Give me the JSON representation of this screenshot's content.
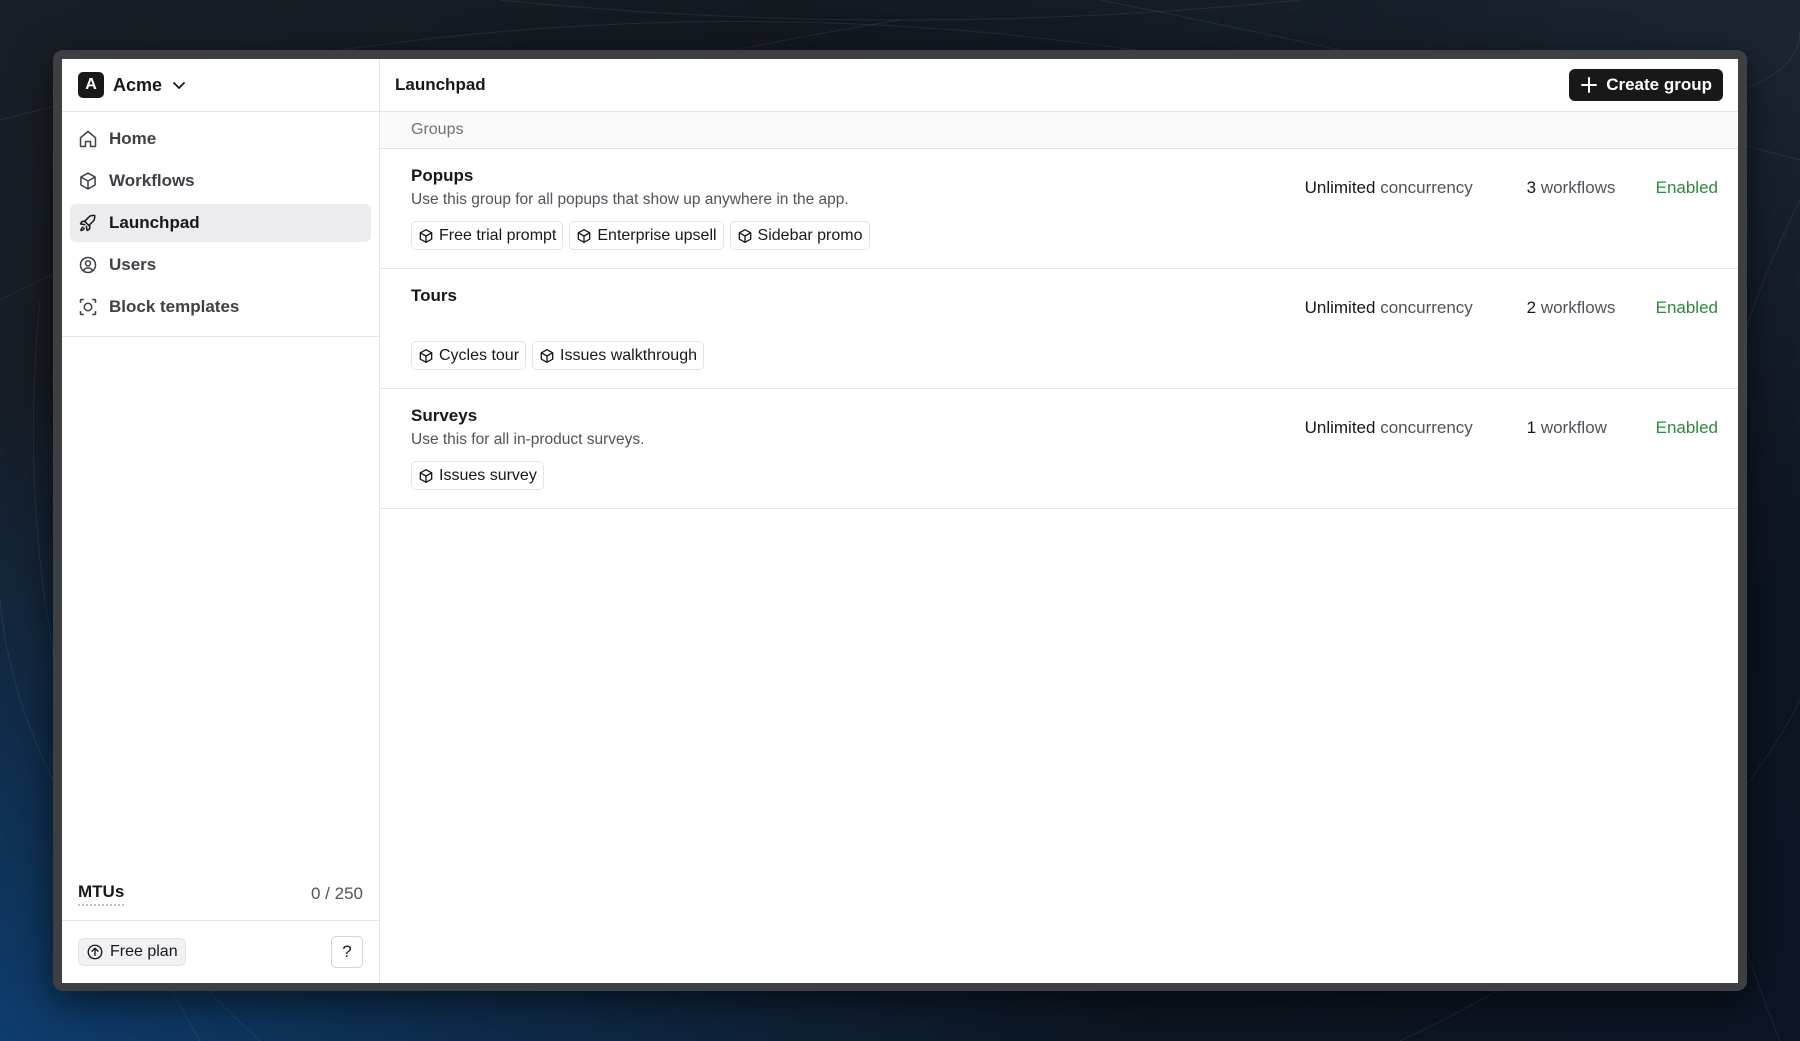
{
  "workspace": {
    "initial": "A",
    "name": "Acme"
  },
  "sidebar": {
    "items": [
      {
        "label": "Home",
        "icon": "home-icon"
      },
      {
        "label": "Workflows",
        "icon": "box-icon"
      },
      {
        "label": "Launchpad",
        "icon": "rocket-icon",
        "active": true
      },
      {
        "label": "Users",
        "icon": "user-circle-icon"
      },
      {
        "label": "Block templates",
        "icon": "block-template-icon"
      }
    ],
    "mtus_label": "MTUs",
    "mtus_value": "0 / 250",
    "plan_label": "Free plan",
    "help_label": "?"
  },
  "header": {
    "title": "Launchpad",
    "create_label": "Create group"
  },
  "section_label": "Groups",
  "groups": [
    {
      "name": "Popups",
      "description": "Use this group for all popups that show up anywhere in the app.",
      "chips": [
        "Free trial prompt",
        "Enterprise upsell",
        "Sidebar promo"
      ],
      "concurrency_value": "Unlimited",
      "concurrency_label": "concurrency",
      "workflow_count": "3",
      "workflow_label": "workflows",
      "status": "Enabled"
    },
    {
      "name": "Tours",
      "description": "",
      "chips": [
        "Cycles tour",
        "Issues walkthrough"
      ],
      "concurrency_value": "Unlimited",
      "concurrency_label": "concurrency",
      "workflow_count": "2",
      "workflow_label": "workflows",
      "status": "Enabled"
    },
    {
      "name": "Surveys",
      "description": "Use this for all in-product surveys.",
      "chips": [
        "Issues survey"
      ],
      "concurrency_value": "Unlimited",
      "concurrency_label": "concurrency",
      "workflow_count": "1",
      "workflow_label": "workflow",
      "status": "Enabled"
    }
  ],
  "colors": {
    "accent": "#18181b",
    "enabled": "#2f8a3b",
    "active_nav": "#ececee"
  }
}
